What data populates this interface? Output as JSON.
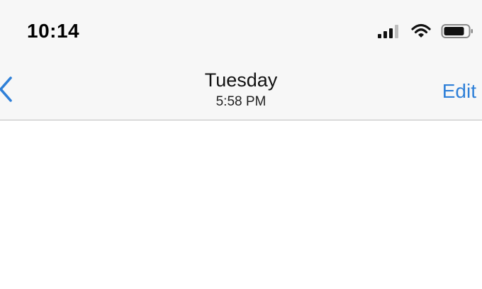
{
  "status_bar": {
    "time": "10:14",
    "icons": [
      "cellular-signal-icon",
      "wifi-icon",
      "battery-icon"
    ]
  },
  "nav_bar": {
    "back_icon": "chevron-left-icon",
    "title": "Tuesday",
    "subtitle": "5:58 PM",
    "edit_label": "Edit"
  },
  "colors": {
    "accent": "#2f80d8",
    "bar_background": "#f7f7f7",
    "separator": "#bdbdbd"
  }
}
